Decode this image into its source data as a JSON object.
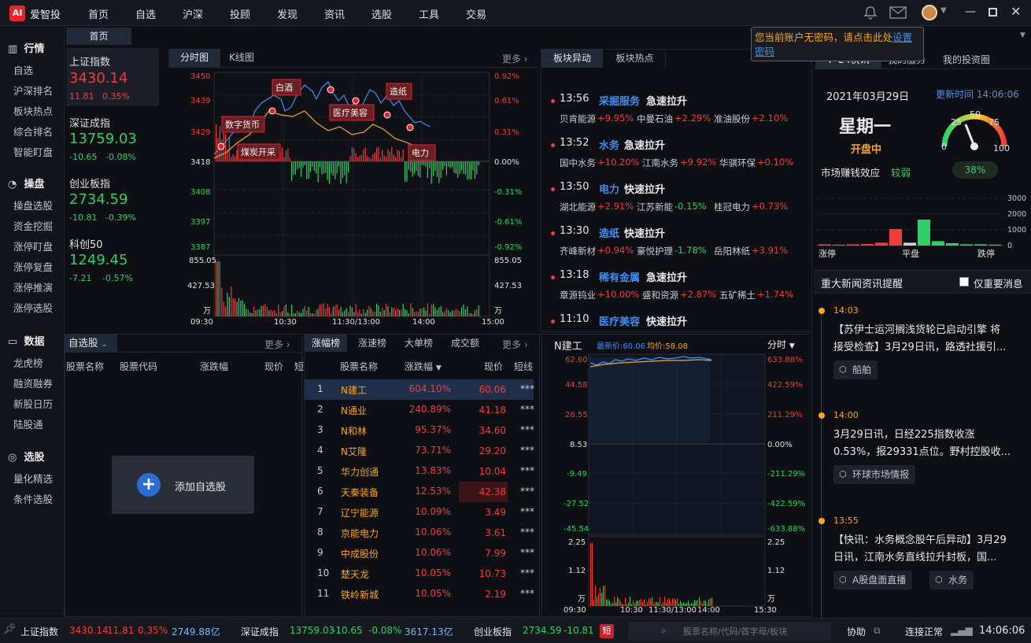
{
  "app": {
    "name": "爱智投",
    "logo": "AI"
  },
  "nav": [
    "首页",
    "自选",
    "沪深",
    "投顾",
    "发现",
    "资讯",
    "选股",
    "工具",
    "交易"
  ],
  "tooltip": {
    "text": "您当前账户无密码，请点击此处",
    "link": "设置密码"
  },
  "home_tab": "首页",
  "sidebar": {
    "sections": [
      {
        "title": "行情",
        "icon": "chart-icon",
        "items": [
          "自选",
          "沪深排名",
          "板块热点",
          "综合排名",
          "智能盯盘"
        ]
      },
      {
        "title": "操盘",
        "icon": "gauge-icon",
        "items": [
          "操盘选股",
          "资金挖掘",
          "涨停盯盘",
          "涨停复盘",
          "涨停推演",
          "涨停选股"
        ]
      },
      {
        "title": "数据",
        "icon": "monitor-icon",
        "items": [
          "龙虎榜",
          "融资融券",
          "新股日历",
          "陆股通"
        ]
      },
      {
        "title": "选股",
        "icon": "target-icon",
        "items": [
          "量化精选",
          "条件选股"
        ]
      }
    ]
  },
  "indices": [
    {
      "name": "上证指数",
      "value": "3430.14",
      "chg": "11.81",
      "pct": "0.35%",
      "color": "#f23c3c"
    },
    {
      "name": "深证成指",
      "value": "13759.03",
      "chg": "-10.65",
      "pct": "-0.08%",
      "color": "#2fd06a"
    },
    {
      "name": "创业板指",
      "value": "2734.59",
      "chg": "-10.81",
      "pct": "-0.39%",
      "color": "#2fd06a"
    },
    {
      "name": "科创50",
      "value": "1249.45",
      "chg": "-7.21",
      "pct": "-0.57%",
      "color": "#2fd06a"
    }
  ],
  "chart_tabs": [
    "分时图",
    "K线图"
  ],
  "more": "更多",
  "main_chart": {
    "y_left": [
      "3450",
      "3439",
      "3429",
      "3418",
      "3408",
      "3397",
      "3387"
    ],
    "y_right": [
      "0.92%",
      "0.61%",
      "0.31%",
      "0.00%",
      "-0.31%",
      "-0.61%",
      "-0.92%"
    ],
    "vol_left": [
      "855.05",
      "427.53",
      "万"
    ],
    "vol_right": [
      "855.05",
      "427.53",
      "万"
    ],
    "x": [
      "09:30",
      "10:30",
      "11:30/13:00",
      "14:00",
      "15:00"
    ],
    "tags": [
      "数字货币",
      "煤炭开采",
      "白酒",
      "医疗美容",
      "造纸",
      "电力"
    ]
  },
  "block_tabs": [
    "板块异动",
    "板块热点"
  ],
  "block_news": [
    {
      "time": "13:56",
      "sector": "采掘服务",
      "action": "急速拉升",
      "stocks": [
        [
          "贝肯能源",
          "+9.95%"
        ],
        [
          "中曼石油",
          "+2.29%"
        ],
        [
          "准油股份",
          "+2.10%"
        ]
      ]
    },
    {
      "time": "13:52",
      "sector": "水务",
      "action": "急速拉升",
      "stocks": [
        [
          "国中水务",
          "+10.20%"
        ],
        [
          "江南水务",
          "+9.92%"
        ],
        [
          "华骐环保",
          "+0.10%"
        ]
      ]
    },
    {
      "time": "13:50",
      "sector": "电力",
      "action": "快速拉升",
      "stocks": [
        [
          "湖北能源",
          "+2.91%"
        ],
        [
          "江苏新能",
          "-0.15%"
        ],
        [
          "桂冠电力",
          "+0.73%"
        ]
      ]
    },
    {
      "time": "13:30",
      "sector": "造纸",
      "action": "快速拉升",
      "stocks": [
        [
          "齐峰新材",
          "+0.94%"
        ],
        [
          "豪悦护理",
          "-1.78%"
        ],
        [
          "岳阳林纸",
          "+3.91%"
        ]
      ]
    },
    {
      "time": "13:18",
      "sector": "稀有金属",
      "action": "急速拉升",
      "stocks": [
        [
          "章源钨业",
          "+10.00%"
        ],
        [
          "盛和资源",
          "+2.87%"
        ],
        [
          "五矿稀土",
          "+1.74%"
        ]
      ]
    },
    {
      "time": "11:10",
      "sector": "医疗美容",
      "action": "快速拉升",
      "stocks": []
    }
  ],
  "right_tabs": [
    "7*24快讯",
    "我的服务",
    "我的投资圈"
  ],
  "market": {
    "date": "2021年03月29日",
    "update": "更新时间 14:06:06",
    "weekday": "星期一",
    "status": "开盘中",
    "effect_label": "市场赚钱效应",
    "effect": "较弱",
    "pct": "38%",
    "gauge": {
      "value": 38,
      "labels": [
        "0",
        "25",
        "50",
        "75",
        "100"
      ]
    },
    "bars_y": [
      "3000",
      "2000",
      "1000",
      "0"
    ],
    "bars_x": [
      "涨停",
      "平盘",
      "跌停"
    ],
    "bars": [
      {
        "v": 80,
        "c": "red"
      },
      {
        "v": 60,
        "c": "red"
      },
      {
        "v": 80,
        "c": "red"
      },
      {
        "v": 100,
        "c": "red"
      },
      {
        "v": 180,
        "c": "red"
      },
      {
        "v": 1050,
        "c": "red"
      },
      {
        "v": 180,
        "c": "gray"
      },
      {
        "v": 1650,
        "c": "green"
      },
      {
        "v": 280,
        "c": "green"
      },
      {
        "v": 150,
        "c": "green"
      },
      {
        "v": 80,
        "c": "green"
      },
      {
        "v": 80,
        "c": "green"
      },
      {
        "v": 60,
        "c": "green"
      }
    ]
  },
  "news_header": {
    "title": "重大新闻资讯提醒",
    "filter": "仅重要消息"
  },
  "news": [
    {
      "time": "14:03",
      "text1": "【苏伊士运河搁浅货轮已启动引擎 将",
      "text2": "接受检查】3月29日讯，路透社援引...",
      "tags": [
        "船舶"
      ]
    },
    {
      "time": "14:00",
      "text1": "3月29日讯，日经225指数收涨",
      "text2": "0.53%，报29331点位。野村控股收...",
      "tags": [
        "环球市场情报"
      ]
    },
    {
      "time": "13:55",
      "text1": "【快讯：水务概念股午后异动】3月29",
      "text2": "日讯，江南水务直线拉升封板，国...",
      "tags": [
        "A股盘面直播",
        "水务"
      ]
    }
  ],
  "watch": {
    "tab": "自选股",
    "more": "更多",
    "cols": [
      "股票名称",
      "股票代码",
      "涨跌幅",
      "现价",
      "短"
    ],
    "add": "添加自选股"
  },
  "rank": {
    "tabs": [
      "涨幅榜",
      "涨速榜",
      "大单榜",
      "成交额"
    ],
    "more": "更多",
    "cols": [
      "股票名称",
      "涨跌幅",
      "现价",
      "短线"
    ],
    "rows": [
      [
        "1",
        "N建工",
        "604.10%",
        "60.06",
        "***"
      ],
      [
        "2",
        "N通业",
        "240.89%",
        "41.18",
        "***"
      ],
      [
        "3",
        "N和林",
        "95.37%",
        "34.60",
        "***"
      ],
      [
        "4",
        "N艾隆",
        "73.71%",
        "29.20",
        "***"
      ],
      [
        "5",
        "华力创通",
        "13.83%",
        "10.04",
        "***"
      ],
      [
        "6",
        "天秦装备",
        "12.53%",
        "42.38",
        "***"
      ],
      [
        "7",
        "辽宁能源",
        "10.09%",
        "3.49",
        "***"
      ],
      [
        "8",
        "京能电力",
        "10.06%",
        "3.61",
        "***"
      ],
      [
        "9",
        "中成股份",
        "10.06%",
        "7.99",
        "***"
      ],
      [
        "10",
        "楚天龙",
        "10.05%",
        "10.73",
        "***"
      ],
      [
        "11",
        "铁岭新城",
        "10.05%",
        "2.19",
        "***"
      ]
    ]
  },
  "stock_chart": {
    "name": "N建工",
    "latest": "最新价:60.06",
    "avg": "均价:58.08",
    "period": "分时",
    "y_left": [
      "62.60",
      "44.58",
      "26.55",
      "8.53",
      "-9.49",
      "-27.52",
      "-45.54"
    ],
    "y_right": [
      "633.88%",
      "422.59%",
      "211.29%",
      "0.00%",
      "-211.29%",
      "-422.59%",
      "-633.88%"
    ],
    "vol_left": [
      "2.25",
      "1.12",
      "万"
    ],
    "vol_right": [
      "2.25",
      "1.12",
      "万"
    ],
    "x": [
      "09:30",
      "10:30",
      "11:30/13:00",
      "14:00",
      "15:30"
    ]
  },
  "statusbar": {
    "i1": [
      "上证指数",
      "3430.14",
      "11.81",
      "0.35%",
      "2749.88亿"
    ],
    "i2": [
      "深证成指",
      "13759.03",
      "-10.65",
      "-0.08%",
      "3617.13亿"
    ],
    "i3": [
      "创业板指",
      "2734.59",
      "-10.81"
    ],
    "short": "短",
    "search_placeholder": "股票名称/代码/首字母/板块",
    "assist": "协助",
    "conn": "连接正常",
    "time": "14:06:06"
  }
}
